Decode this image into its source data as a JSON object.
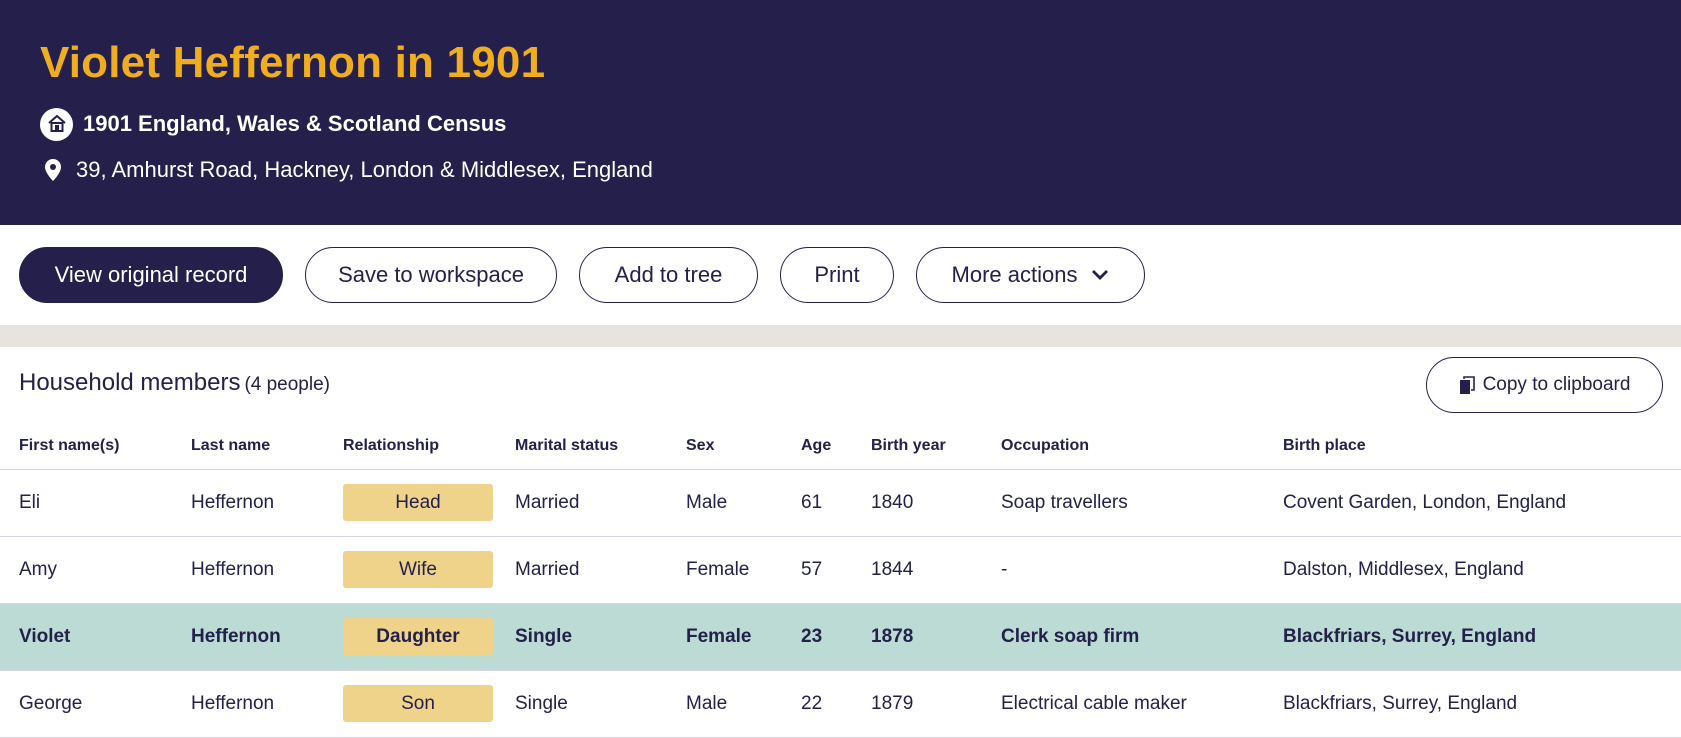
{
  "header": {
    "title": "Violet Heffernon in 1901",
    "collection": "1901 England, Wales & Scotland Census",
    "collection_icon": "house-icon",
    "location": "39, Amhurst Road, Hackney, London & Middlesex, England",
    "location_icon": "map-pin-icon",
    "background_color": "#25204b",
    "title_color": "#f0ad1e"
  },
  "actions": {
    "view_original": "View original record",
    "save_workspace": "Save to workspace",
    "add_tree": "Add to tree",
    "print": "Print",
    "more_actions": "More actions"
  },
  "household": {
    "title": "Household members",
    "count": "(4 people)",
    "copy_label": "Copy to clipboard",
    "columns": [
      "First name(s)",
      "Last name",
      "Relationship",
      "Marital status",
      "Sex",
      "Age",
      "Birth year",
      "Occupation",
      "Birth place"
    ],
    "rows": [
      {
        "first": "Eli",
        "last": "Heffernon",
        "relationship": "Head",
        "marital": "Married",
        "sex": "Male",
        "age": "61",
        "birth_year": "1840",
        "occupation": "Soap travellers",
        "birth_place": "Covent Garden, London, England"
      },
      {
        "first": "Amy",
        "last": "Heffernon",
        "relationship": "Wife",
        "marital": "Married",
        "sex": "Female",
        "age": "57",
        "birth_year": "1844",
        "occupation": "-",
        "birth_place": "Dalston, Middlesex, England"
      },
      {
        "first": "Violet",
        "last": "Heffernon",
        "relationship": "Daughter",
        "marital": "Single",
        "sex": "Female",
        "age": "23",
        "birth_year": "1878",
        "occupation": "Clerk soap firm",
        "birth_place": "Blackfriars, Surrey, England",
        "highlighted": true
      },
      {
        "first": "George",
        "last": "Heffernon",
        "relationship": "Son",
        "marital": "Single",
        "sex": "Male",
        "age": "22",
        "birth_year": "1879",
        "occupation": "Electrical cable maker",
        "birth_place": "Blackfriars, Surrey, England"
      }
    ],
    "highlight_color": "#bddbd5",
    "relationship_badge_color": "#f0d38b"
  }
}
